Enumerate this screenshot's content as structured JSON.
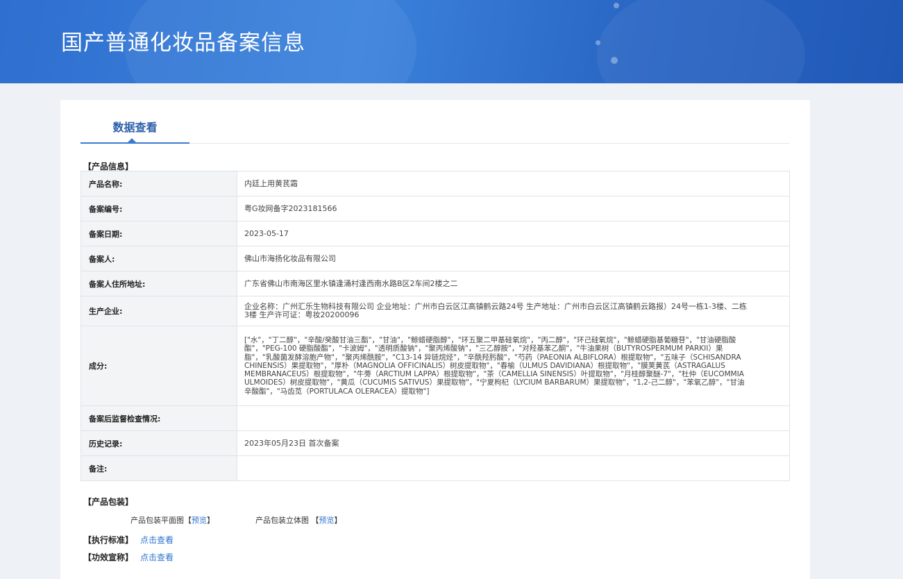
{
  "header": {
    "title": "国产普通化妆品备案信息"
  },
  "tabs": [
    {
      "label": "数据查看"
    }
  ],
  "product_info": {
    "section_title": "【产品信息】",
    "rows": [
      {
        "label": "产品名称:",
        "value": "内廷上用黄芪霜"
      },
      {
        "label": "备案编号:",
        "value": "粤G妆网备字2023181566"
      },
      {
        "label": "备案日期:",
        "value": "2023-05-17"
      },
      {
        "label": "备案人:",
        "value": "佛山市海扬化妆品有限公司"
      },
      {
        "label": "备案人住所地址:",
        "value": "广东省佛山市南海区里水镇逢涌村逢西南水路B区2车间2楼之二"
      },
      {
        "label": "生产企业:",
        "value": "企业名称：广州汇乐生物科技有限公司 企业地址：广州市白云区江高镇鹤云路24号 生产地址：广州市白云区江高镇鹤云路报）24号一栋1-3楼、二栋3楼 生产许可证：粤妆20200096"
      },
      {
        "label": "成分:",
        "value": "[\"水\"，\"丁二醇\"，\"辛酸/癸酸甘油三酯\"，\"甘油\"，\"鲸蜡硬脂醇\"，\"环五聚二甲基硅氧烷\"，\"丙二醇\"，\"环己硅氧烷\"，\"鲸蜡硬脂基葡糖苷\"，\"甘油硬脂酸酯\"，\"PEG-100 硬脂酸酯\"，\"卡波姆\"，\"透明质酸钠\"，\"聚丙烯酸钠\"，\"三乙醇胺\"，\"对羟基苯乙酮\"，\"牛油果树（BUTYROSPERMUM PARKII）果脂\"，\"乳酸菌发酵溶胞产物\"，\"聚丙烯酰胺\"，\"C13-14 异链烷烃\"，\"辛酰羟肟酸\"，\"芍药（PAEONIA ALBIFLORA）根提取物\"，\"五味子（SCHISANDRA CHINENSIS）果提取物\"，\"厚朴（MAGNOLIA OFFICINALIS）树皮提取物\"，\"春榆（ULMUS DAVIDIANA）根提取物\"，\"膜荚黄芪（ASTRAGALUS MEMBRANACEUS）根提取物\"，\"牛蒡（ARCTIUM LAPPA）根提取物\"，\"茶（CAMELLIA SINENSIS）叶提取物\"，\"月桂醇聚醚-7\"，\"杜仲（EUCOMMIA ULMOIDES）树皮提取物\"，\"黄瓜（CUCUMIS SATIVUS）果提取物\"，\"宁夏枸杞（LYCIUM BARBARUM）果提取物\"，\"1,2-己二醇\"，\"苯氧乙醇\"，\"甘油辛酸酯\"，\"马齿苋（PORTULACA OLERACEA）提取物\"]"
      },
      {
        "label": "备案后监督检查情况:",
        "value": ""
      },
      {
        "label": "历史记录:",
        "value": "2023年05月23日 首次备案"
      },
      {
        "label": "备注:",
        "value": ""
      }
    ]
  },
  "packaging": {
    "section_title": "【产品包装】",
    "flat_label": "产品包装平面图",
    "three_d_label": "产品包装立体图",
    "preview_link": "预览",
    "bracket_open": "【",
    "bracket_close": "】"
  },
  "standard": {
    "label": "【执行标准】",
    "link": "点击查看"
  },
  "efficacy": {
    "label": "【功效宣称】",
    "link": "点击查看"
  }
}
